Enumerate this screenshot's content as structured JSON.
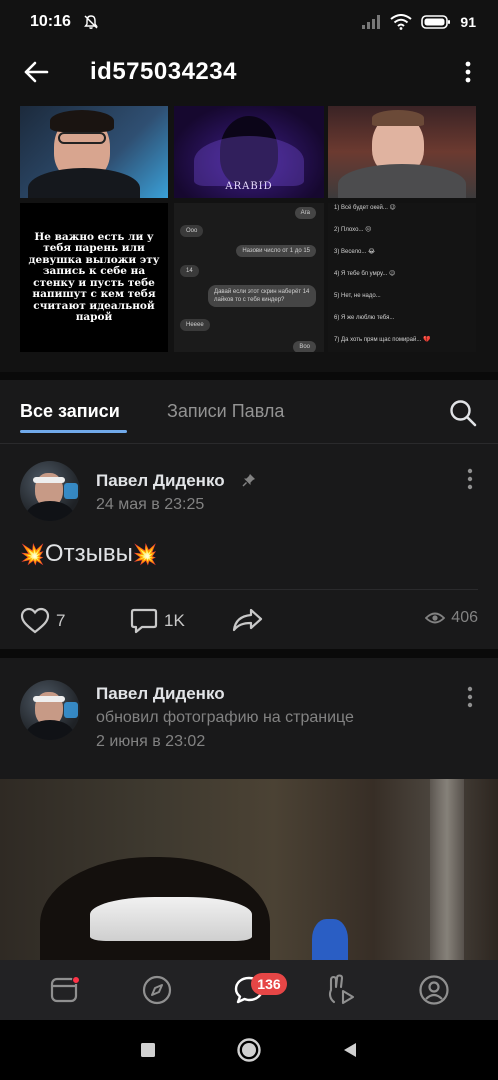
{
  "status_bar": {
    "time": "10:16",
    "battery_percent": "91"
  },
  "header": {
    "title": "id575034234",
    "back_icon": "arrow-left-icon",
    "menu_icon": "more-vertical-icon"
  },
  "gallery": {
    "tile2_caption": "ARABID",
    "meme_text": "Не важно есть ли у тебя парень или девушка выложи эту запись к себе на стенку и пусть тебе напишут с кем тебя считают идеальной парой",
    "chat": {
      "m1": "Ага",
      "m2": "Ооо",
      "m3": "Назови число от 1 до 15",
      "m4": "14",
      "m5": "Давай если этот скрин наберёт 14 лайков то с тебя киндер?",
      "m6": "Нееее",
      "m7": "Воо"
    },
    "list": {
      "l1": "1) Всё будет окей... 😉",
      "l2": "2) Плохо... 😔",
      "l3": "3) Весело... 😂",
      "l4": "4) Я тебе бл умру... 😉",
      "l5": "5) Нет, не надо...",
      "l6": "6) Я же люблю тебя...",
      "l7": "7) Да хоть прям щас помирай... 💔"
    }
  },
  "tabs": {
    "all_label": "Все записи",
    "pavel_label": "Записи Павла",
    "search_icon": "search-icon"
  },
  "posts": [
    {
      "author": "Павел Диденко",
      "date": "24 мая в 23:25",
      "text_prefix": "💥",
      "text": "Отзывы",
      "text_suffix": "💥",
      "likes": "7",
      "comments": "1K",
      "views": "406"
    },
    {
      "author": "Павел Диденко",
      "action": "обновил фотографию на странице",
      "date": "2 июня в 23:02"
    }
  ],
  "bottom_nav": {
    "messages_badge": "136"
  },
  "colors": {
    "accent": "#71aaeb",
    "badge": "#e64646",
    "card": "#19191a",
    "background": "#0a0a0a"
  }
}
